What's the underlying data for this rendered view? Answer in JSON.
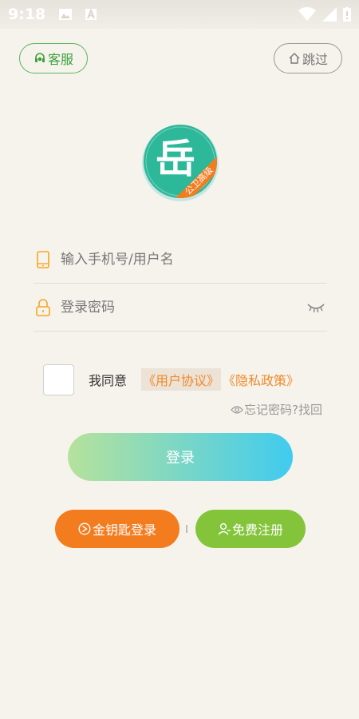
{
  "status_bar": {
    "time": "9:18"
  },
  "header": {
    "service_label": "客服",
    "skip_label": "跳过"
  },
  "logo": {
    "main_glyph": "岳",
    "ribbon_text": "公卫高级"
  },
  "form": {
    "phone_placeholder": "输入手机号/用户名",
    "password_placeholder": "登录密码"
  },
  "agreement": {
    "prefix": "我同意",
    "user_agreement": "《用户协议》",
    "privacy_policy": "《隐私政策》"
  },
  "forgot_password": "忘记密码?找回",
  "login_button": "登录",
  "alt_login": {
    "key_login": "金钥匙登录",
    "register": "免费注册"
  },
  "colors": {
    "background": "#f6f3ec",
    "accent_green": "#5bb55b",
    "orange": "#f37c1f",
    "register_green": "#84c43b",
    "link_orange": "#f08a2a"
  }
}
